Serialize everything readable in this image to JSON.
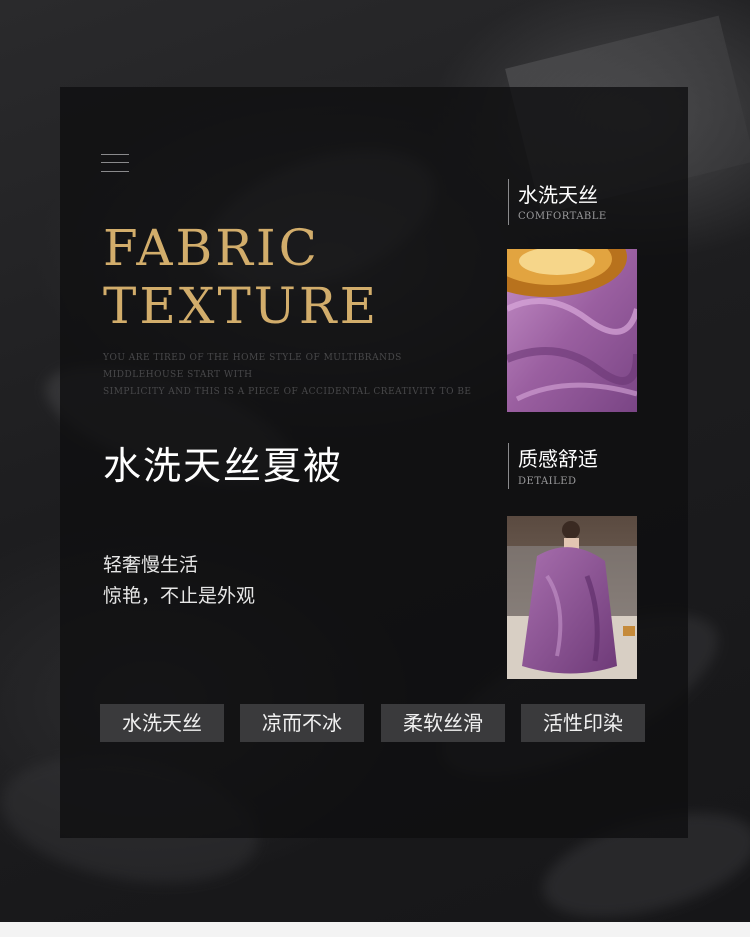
{
  "hero": {
    "title_line1": "FABRIC",
    "title_line2": "TEXTURE",
    "sub_line1": "YOU ARE TIRED OF THE HOME STYLE OF MULTIBRANDS MIDDLEHOUSE START WITH",
    "sub_line2": "SIMPLICITY AND THIS IS A PIECE OF ACCIDENTAL CREATIVITY TO BE",
    "heading": "水洗天丝夏被",
    "tagline1": "轻奢慢生活",
    "tagline2": "惊艳，不止是外观"
  },
  "features": [
    "水洗天丝",
    "凉而不冰",
    "柔软丝滑",
    "活性印染"
  ],
  "side": [
    {
      "cn": "水洗天丝",
      "en": "COMFORTABLE"
    },
    {
      "cn": "质感舒适",
      "en": "DETAILED"
    }
  ],
  "colors": {
    "gold": "#d2ad6b",
    "panel": "#0e0e10",
    "fabric_purple": "#9a5fa0",
    "tag_bg": "#3a3a3c"
  },
  "icons": [
    "menu-icon"
  ]
}
